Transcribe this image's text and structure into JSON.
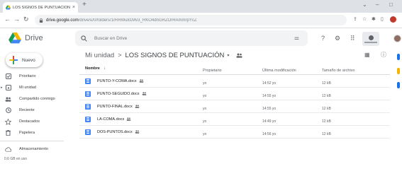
{
  "browser": {
    "tab_title": "LOS SIGNOS DE PUNTUACIÓN -",
    "tab_close": "×",
    "new_tab": "+",
    "url_host": "drive.google.com",
    "url_path": "/drive/u/0/folders/1rRRWu81Mv3_RKO4dnGRZOrRAmmrpYcZ",
    "controls": {
      "minimize": "–",
      "restore": "□",
      "chevron": "⌄"
    }
  },
  "drive": {
    "product_name": "Drive",
    "search_placeholder": "Buscar en Drive",
    "new_button_label": "Nuevo"
  },
  "sidebar": {
    "items": [
      {
        "label": "Prioritario",
        "icon": "checkbox-icon"
      },
      {
        "label": "Mi unidad",
        "icon": "my-drive-icon"
      },
      {
        "label": "Compartido conmigo",
        "icon": "people-icon"
      },
      {
        "label": "Reciente",
        "icon": "clock-icon"
      },
      {
        "label": "Destacados",
        "icon": "star-icon"
      },
      {
        "label": "Papelera",
        "icon": "trash-icon"
      }
    ],
    "storage_label": "Almacenamiento",
    "storage_used": "0,6 GB en uso"
  },
  "breadcrumb": {
    "root": "Mi unidad",
    "separator": ">",
    "current": "LOS SIGNOS DE PUNTUACIÓN",
    "caret": "▾"
  },
  "table": {
    "headers": {
      "name": "Nombre",
      "sort": "↓",
      "owner": "Propietario",
      "modified": "Última modificación",
      "size": "Tamaño de archivo"
    },
    "rows": [
      {
        "name": "PUNTO-Y-COMA.docx",
        "owner": "yo",
        "modified": "14:52 yo",
        "size": "12 kB"
      },
      {
        "name": "PUNTO-SEGUIDO.docx",
        "owner": "yo",
        "modified": "14:55 yo",
        "size": "12 kB"
      },
      {
        "name": "PUNTO-FINAL.docx",
        "owner": "yo",
        "modified": "14:55 yo",
        "size": "12 kB"
      },
      {
        "name": "LA-COMA.docx",
        "owner": "yo",
        "modified": "14:49 yo",
        "size": "12 kB"
      },
      {
        "name": "DOS-PUNTOS.docx",
        "owner": "yo",
        "modified": "14:56 yo",
        "size": "12 kB"
      }
    ]
  },
  "colors": {
    "accent_blue": "#1a73e8",
    "doc_blue": "#4285f4",
    "drive_green": "#0f9d58",
    "drive_yellow": "#f4b400",
    "drive_red": "#db4437"
  }
}
